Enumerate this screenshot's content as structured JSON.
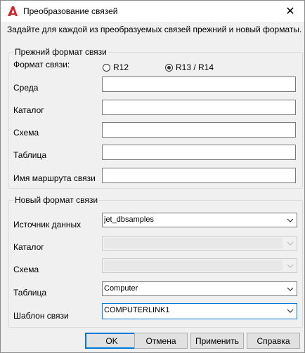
{
  "window": {
    "title": "Преобразование связей",
    "close_glyph": "✕"
  },
  "instruction": "Задайте для каждой из преобразуемых связей прежний и новый форматы.",
  "old_format": {
    "group_title": "Прежний формат связи",
    "format_label": "Формат связи:",
    "radio_r12": "R12",
    "radio_r13": "R13 / R14",
    "selected": "R13 / R14",
    "fields": {
      "environment": "Среда",
      "catalog": "Каталог",
      "schema": "Схема",
      "table": "Таблица",
      "path_name": "Имя маршрута связи"
    },
    "values": {
      "environment": "",
      "catalog": "",
      "schema": "",
      "table": "",
      "path_name": ""
    }
  },
  "new_format": {
    "group_title": "Новый формат связи",
    "fields": {
      "data_source": "Источник данных",
      "catalog": "Каталог",
      "schema": "Схема",
      "table": "Таблица",
      "template": "Шаблон связи"
    },
    "values": {
      "data_source": "jet_dbsamples",
      "catalog": "",
      "schema": "",
      "table": "Computer",
      "template": "COMPUTERLINK1"
    }
  },
  "buttons": {
    "ok": "OK",
    "cancel": "Отмена",
    "apply": "Применить",
    "help": "Справка"
  },
  "colors": {
    "accent": "#0078d7",
    "app_icon": "#d0232a"
  }
}
